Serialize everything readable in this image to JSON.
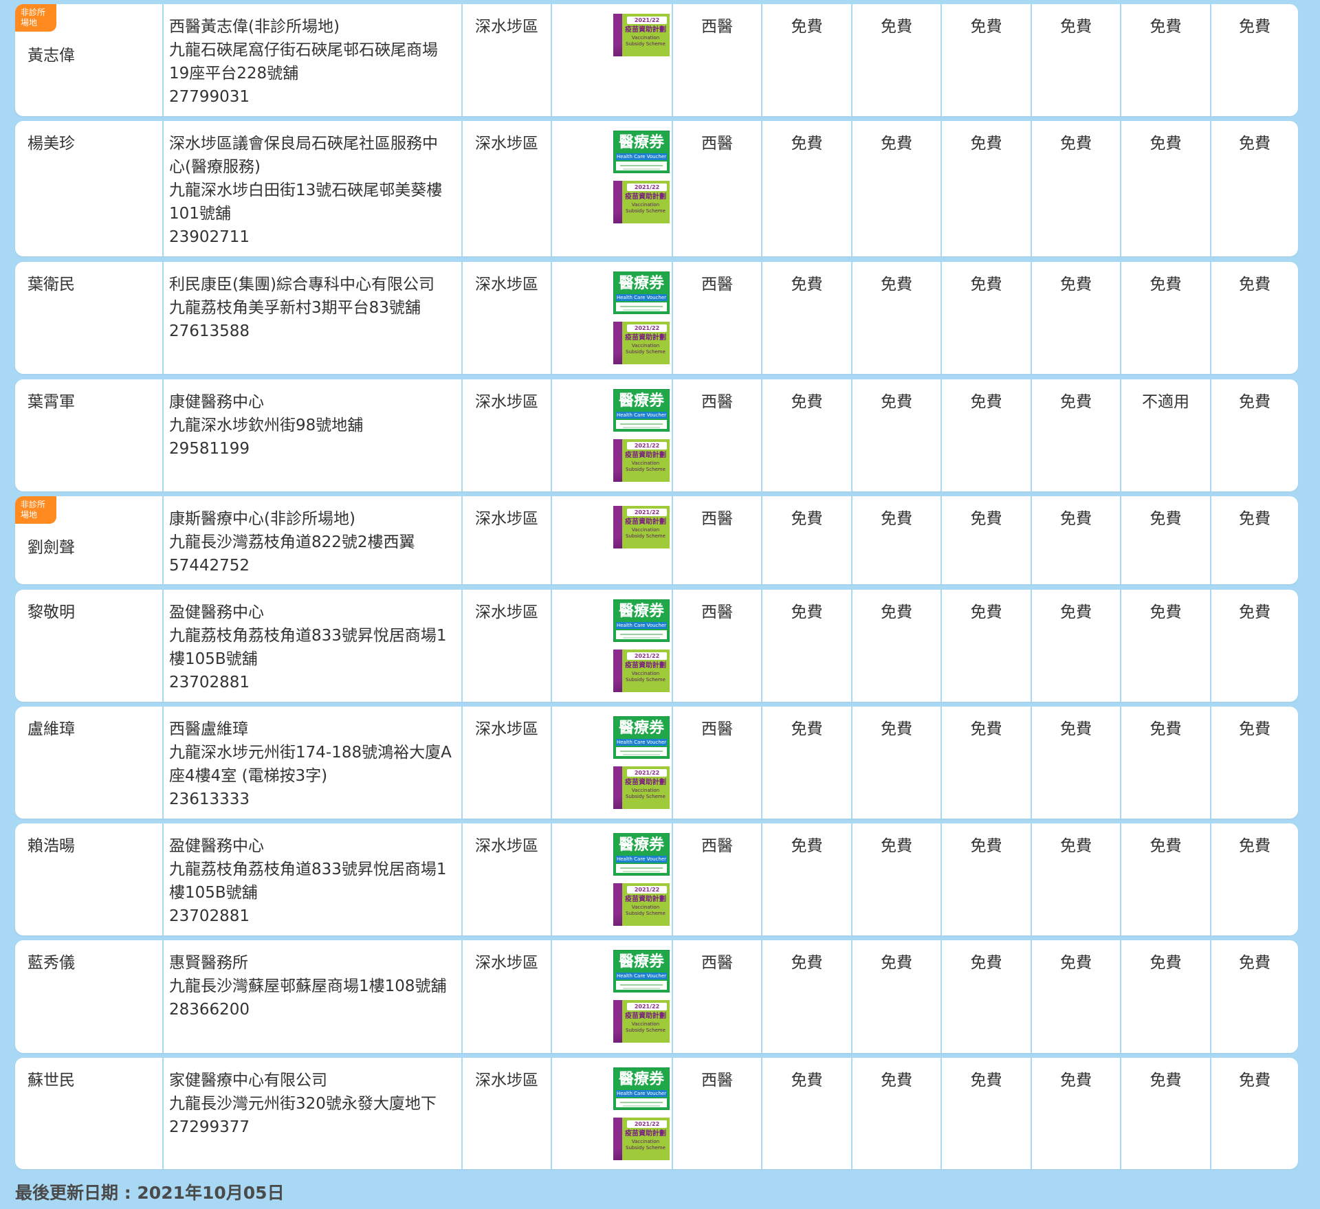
{
  "rows": [
    {
      "name": "黃志偉",
      "badge": "非診所\n場地",
      "address": [
        "西醫黃志偉(非診所場地)",
        "九龍石硤尾窩仔街石硤尾邨石硤尾商場",
        "19座平台228號舖",
        "27799031"
      ],
      "district": "深水埗區",
      "voucher_icons": [
        "vaccination-subsidy-scheme-icon"
      ],
      "type": "西醫",
      "fees": [
        "免費",
        "免費",
        "免費",
        "免費",
        "免費",
        "免費"
      ]
    },
    {
      "name": "楊美珍",
      "badge": "",
      "address": [
        "深水埗區議會保良局石硤尾社區服務中",
        "心(醫療服務)",
        "九龍深水埗白田街13號石硤尾邨美葵樓",
        "101號舖",
        "23902711"
      ],
      "district": "深水埗區",
      "voucher_icons": [
        "health-care-voucher-icon",
        "vaccination-subsidy-scheme-icon"
      ],
      "type": "西醫",
      "fees": [
        "免費",
        "免費",
        "免費",
        "免費",
        "免費",
        "免費"
      ]
    },
    {
      "name": "葉衛民",
      "badge": "",
      "address": [
        "利民康臣(集團)綜合專科中心有限公司",
        "九龍荔枝角美孚新村3期平台83號舖",
        "27613588"
      ],
      "district": "深水埗區",
      "voucher_icons": [
        "health-care-voucher-icon",
        "vaccination-subsidy-scheme-icon"
      ],
      "type": "西醫",
      "fees": [
        "免費",
        "免費",
        "免費",
        "免費",
        "免費",
        "免費"
      ]
    },
    {
      "name": "葉霄軍",
      "badge": "",
      "address": [
        "康健醫務中心",
        "九龍深水埗欽州街98號地舖",
        "29581199"
      ],
      "district": "深水埗區",
      "voucher_icons": [
        "health-care-voucher-icon",
        "vaccination-subsidy-scheme-icon"
      ],
      "type": "西醫",
      "fees": [
        "免費",
        "免費",
        "免費",
        "免費",
        "不適用",
        "免費"
      ]
    },
    {
      "name": "劉劍聲",
      "badge": "非診所\n場地",
      "address": [
        "康斯醫療中心(非診所場地)",
        "九龍長沙灣荔枝角道822號2樓西翼",
        "57442752"
      ],
      "district": "深水埗區",
      "voucher_icons": [
        "vaccination-subsidy-scheme-icon"
      ],
      "type": "西醫",
      "fees": [
        "免費",
        "免費",
        "免費",
        "免費",
        "免費",
        "免費"
      ]
    },
    {
      "name": "黎敬明",
      "badge": "",
      "address": [
        "盈健醫務中心",
        "九龍荔枝角荔枝角道833號昇悅居商場1",
        "樓105B號舖",
        "23702881"
      ],
      "district": "深水埗區",
      "voucher_icons": [
        "health-care-voucher-icon",
        "vaccination-subsidy-scheme-icon"
      ],
      "type": "西醫",
      "fees": [
        "免費",
        "免費",
        "免費",
        "免費",
        "免費",
        "免費"
      ]
    },
    {
      "name": "盧維璋",
      "badge": "",
      "address": [
        "西醫盧維璋",
        "九龍深水埗元州街174-188號鴻裕大廈A",
        "座4樓4室 (電梯按3字)",
        "23613333"
      ],
      "district": "深水埗區",
      "voucher_icons": [
        "health-care-voucher-icon",
        "vaccination-subsidy-scheme-icon"
      ],
      "type": "西醫",
      "fees": [
        "免費",
        "免費",
        "免費",
        "免費",
        "免費",
        "免費"
      ]
    },
    {
      "name": "賴浩暘",
      "badge": "",
      "address": [
        "盈健醫務中心",
        "九龍荔枝角荔枝角道833號昇悅居商場1",
        "樓105B號舖",
        "23702881"
      ],
      "district": "深水埗區",
      "voucher_icons": [
        "health-care-voucher-icon",
        "vaccination-subsidy-scheme-icon"
      ],
      "type": "西醫",
      "fees": [
        "免費",
        "免費",
        "免費",
        "免費",
        "免費",
        "免費"
      ]
    },
    {
      "name": "藍秀儀",
      "badge": "",
      "address": [
        "惠賢醫務所",
        "九龍長沙灣蘇屋邨蘇屋商場1樓108號舖",
        "28366200"
      ],
      "district": "深水埗區",
      "voucher_icons": [
        "health-care-voucher-icon",
        "vaccination-subsidy-scheme-icon"
      ],
      "type": "西醫",
      "fees": [
        "免費",
        "免費",
        "免費",
        "免費",
        "免費",
        "免費"
      ]
    },
    {
      "name": "蘇世民",
      "badge": "",
      "address": [
        "家健醫療中心有限公司",
        "九龍長沙灣元州街320號永發大廈地下",
        "27299377"
      ],
      "district": "深水埗區",
      "voucher_icons": [
        "health-care-voucher-icon",
        "vaccination-subsidy-scheme-icon"
      ],
      "type": "西醫",
      "fees": [
        "免費",
        "免費",
        "免費",
        "免費",
        "免費",
        "免費"
      ]
    }
  ],
  "icons": {
    "health_care_voucher": {
      "zh": "醫療券",
      "en": "Health Care Voucher"
    },
    "vaccination_subsidy": {
      "year": "2021/22",
      "zh": "疫苗資助計劃",
      "en": "Vaccination Subsidy Scheme"
    }
  },
  "footer": {
    "last_updated": "最後更新日期 : 2021年10月05日"
  },
  "colors": {
    "background": "#a9d8f4",
    "badge": "#ff8a1f",
    "voucher_green": "#1fa74a",
    "vss_purple": "#8b2c8d",
    "vss_green": "#9fca3a"
  }
}
